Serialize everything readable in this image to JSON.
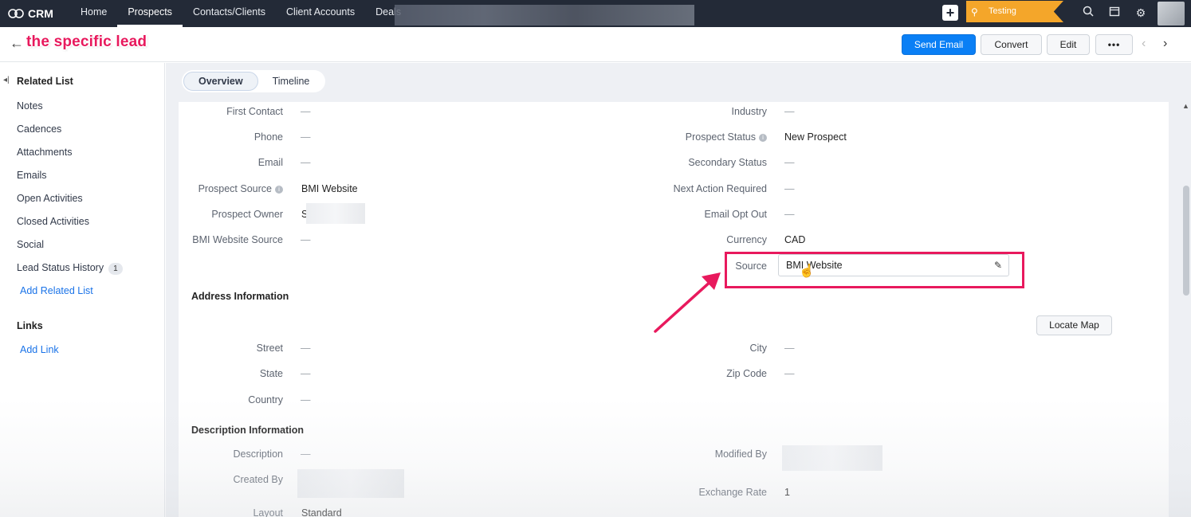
{
  "topnav": {
    "app_name": "CRM",
    "tabs": [
      "Home",
      "Prospects",
      "Contacts/Clients",
      "Client Accounts",
      "Deals"
    ],
    "active_tab": "Prospects",
    "sandbox_label": "Testing",
    "icons": [
      "add-icon",
      "search-icon",
      "calendar-icon",
      "gear-icon"
    ]
  },
  "header": {
    "annotation": "the specific lead",
    "send_email": "Send Email",
    "convert": "Convert",
    "edit": "Edit",
    "more": "•••"
  },
  "sidebar": {
    "related_list_title": "Related List",
    "items": [
      "Notes",
      "Cadences",
      "Attachments",
      "Emails",
      "Open Activities",
      "Closed Activities",
      "Social"
    ],
    "lead_status_history": "Lead Status History",
    "lead_status_history_count": "1",
    "add_related_list": "Add Related List",
    "links_title": "Links",
    "add_link": "Add Link"
  },
  "content": {
    "tabs": [
      "Overview",
      "Timeline"
    ],
    "active_tab": "Overview",
    "left_fields": [
      {
        "label": "First Contact",
        "value": "—"
      },
      {
        "label": "Phone",
        "value": "—"
      },
      {
        "label": "Email",
        "value": "—"
      },
      {
        "label": "Prospect Source",
        "value": "BMI Website"
      },
      {
        "label": "Prospect Owner",
        "value": "S"
      },
      {
        "label": "BMI Website Source",
        "value": "—"
      }
    ],
    "right_fields": [
      {
        "label": "Industry",
        "value": "—"
      },
      {
        "label": "Prospect Status",
        "value": "New Prospect"
      },
      {
        "label": "Secondary Status",
        "value": "—"
      },
      {
        "label": "Next Action Required",
        "value": "—"
      },
      {
        "label": "Email Opt Out",
        "value": "—"
      },
      {
        "label": "Currency",
        "value": "CAD"
      }
    ],
    "source": {
      "label": "Source",
      "value": "BMI Website"
    },
    "address_title": "Address Information",
    "locate_map": "Locate Map",
    "address_left": [
      {
        "label": "Street",
        "value": "—"
      },
      {
        "label": "State",
        "value": "—"
      },
      {
        "label": "Country",
        "value": "—"
      }
    ],
    "address_right": [
      {
        "label": "City",
        "value": "—"
      },
      {
        "label": "Zip Code",
        "value": "—"
      }
    ],
    "description_title": "Description Information",
    "description": {
      "label": "Description",
      "value": "—"
    },
    "created_by": {
      "label": "Created By"
    },
    "modified_by": {
      "label": "Modified By"
    },
    "exchange_rate": {
      "label": "Exchange Rate",
      "value": "1"
    },
    "layout": {
      "label": "Layout",
      "value": "Standard"
    }
  },
  "colors": {
    "topnav_bg": "#232a37",
    "primary_button": "#0a7ff5",
    "annotation": "#e8195d",
    "sandbox_badge": "#f4a62a"
  }
}
